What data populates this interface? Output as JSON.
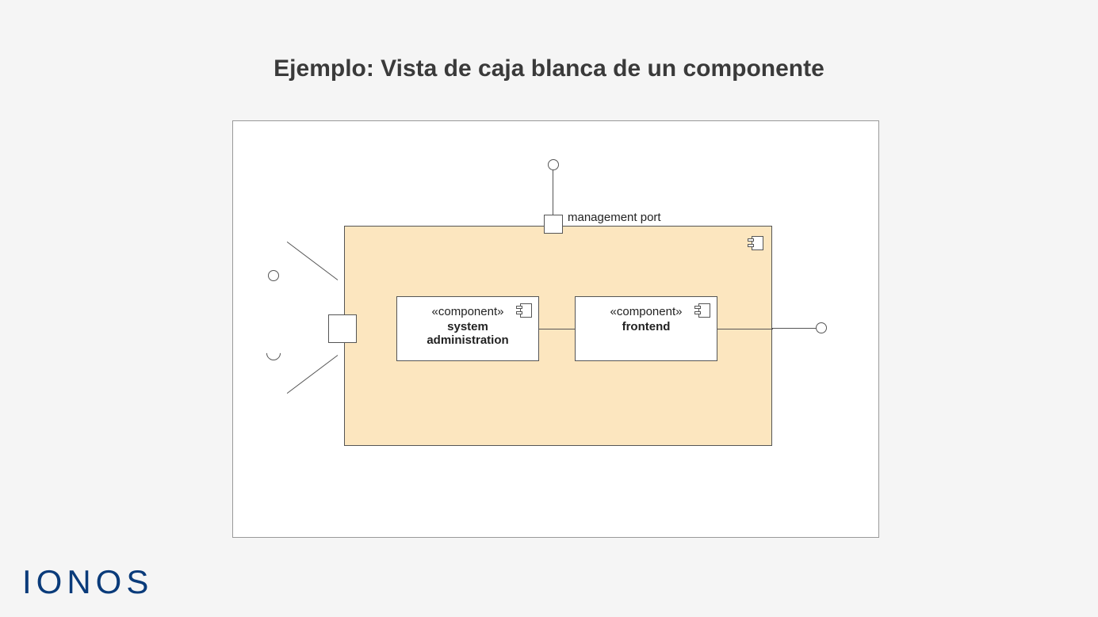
{
  "title": "Ejemplo: Vista de caja blanca de un componente",
  "port_label": "management port",
  "components": {
    "a": {
      "stereo": "«component»",
      "name": "system administration"
    },
    "b": {
      "stereo": "«component»",
      "name": "frontend"
    }
  },
  "brand": "IONOS"
}
